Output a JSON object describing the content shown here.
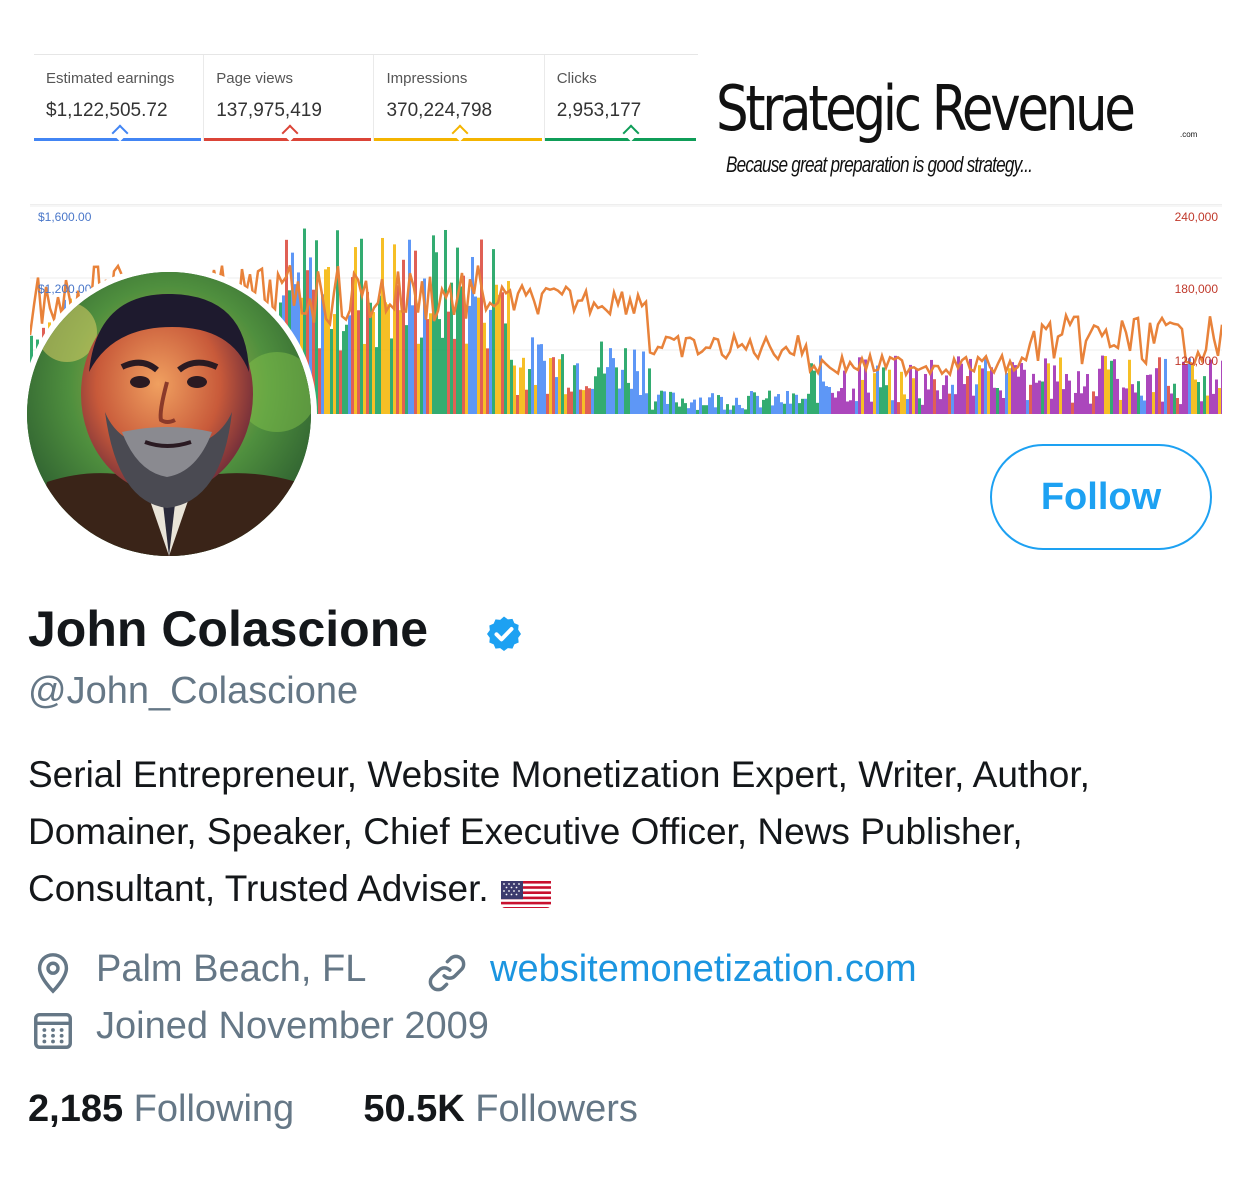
{
  "banner": {
    "stats": [
      {
        "label": "Estimated earnings",
        "value": "$1,122,505.72",
        "color": "#4285f4"
      },
      {
        "label": "Page views",
        "value": "137,975,419",
        "color": "#db4437"
      },
      {
        "label": "Impressions",
        "value": "370,224,798",
        "color": "#f4b400"
      },
      {
        "label": "Clicks",
        "value": "2,953,177",
        "color": "#0f9d58"
      }
    ],
    "brand_title": "Strategic Revenue",
    "brand_suffix": ".com",
    "brand_tagline": "Because great preparation is good strategy...",
    "chart_left_axis": [
      "$1,600.00",
      "$1,200.00"
    ],
    "chart_right_axis": [
      "240,000",
      "180,000",
      "120,000"
    ]
  },
  "profile": {
    "follow_label": "Follow",
    "name": "John Colascione",
    "handle": "@John_Colascione",
    "bio": "Serial Entrepreneur, Website Monetization Expert, Writer, Author, Domainer, Speaker, Chief Executive Officer, News Publisher, Consultant, Trusted Adviser.",
    "location": "Palm Beach, FL",
    "website": "websitemonetization.com",
    "joined": "Joined November 2009",
    "following_count": "2,185",
    "following_label": "Following",
    "followers_count": "50.5K",
    "followers_label": "Followers"
  },
  "colors": {
    "accent": "#1da1f2",
    "link": "#1b95e0",
    "muted": "#657786"
  }
}
